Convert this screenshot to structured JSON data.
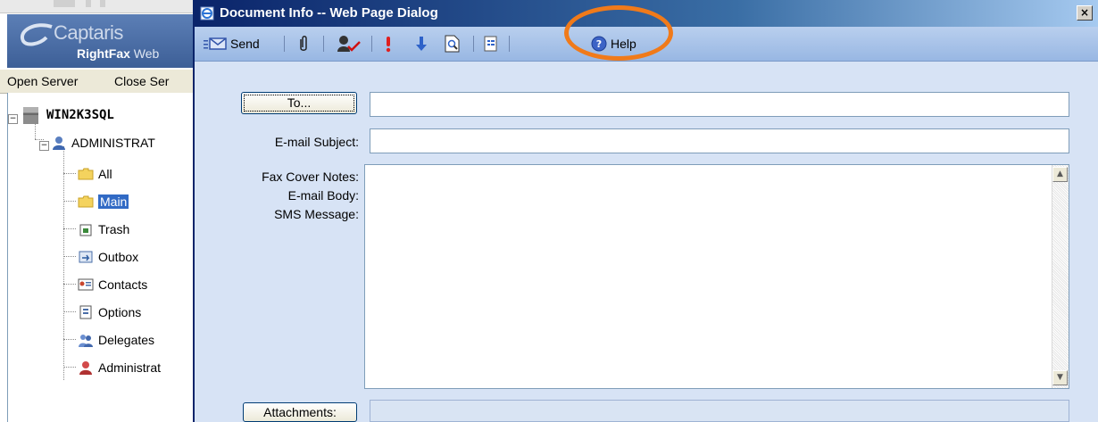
{
  "background_app": {
    "logo": {
      "brand": "Captaris",
      "product_bold": "RightFax",
      "product_rest": " Web"
    },
    "menu": [
      "Open Server",
      "Close Ser"
    ],
    "tree": {
      "server": "WIN2K3SQL",
      "user": "ADMINISTRAT",
      "items": [
        {
          "label": "All",
          "icon": "folder-icon"
        },
        {
          "label": "Main",
          "icon": "folder-icon",
          "selected": true
        },
        {
          "label": "Trash",
          "icon": "trash-icon"
        },
        {
          "label": "Outbox",
          "icon": "outbox-icon"
        },
        {
          "label": "Contacts",
          "icon": "contacts-icon"
        },
        {
          "label": "Options",
          "icon": "options-icon"
        },
        {
          "label": "Delegates",
          "icon": "delegates-icon"
        },
        {
          "label": "Administrat",
          "icon": "administrator-icon"
        }
      ]
    }
  },
  "dialog": {
    "title": "Document Info -- Web Page Dialog",
    "close_label": "×",
    "toolbar": {
      "send_label": "Send",
      "help_label": "Help",
      "icons": [
        "send-icon",
        "attach-icon",
        "signature-icon",
        "priority-icon",
        "low-priority-icon",
        "preview-icon",
        "form-icon",
        "help-icon"
      ]
    },
    "highlight_color": "#f07a1a",
    "form": {
      "to_button": "To...",
      "to_value": "",
      "subject_label": "E-mail Subject:",
      "subject_value": "",
      "notes_label_1": "Fax Cover Notes:",
      "notes_label_2": "E-mail Body:",
      "notes_label_3": "SMS Message:",
      "body_value": "",
      "attachments_button": "Attachments:",
      "attachments_value": ""
    }
  }
}
